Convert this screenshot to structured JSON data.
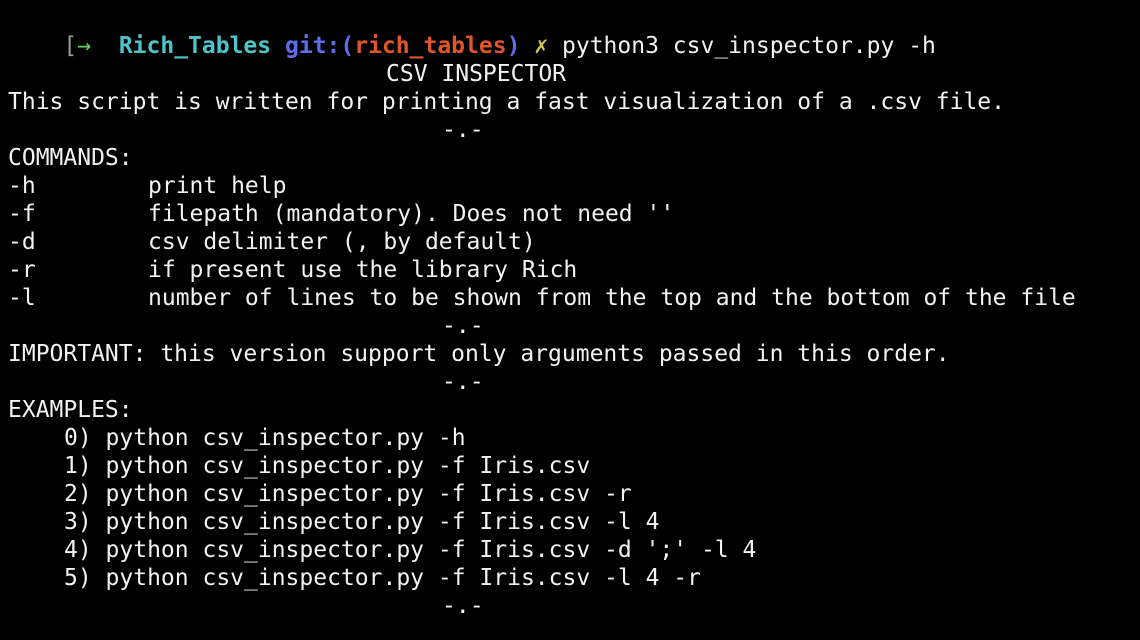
{
  "prompt": {
    "bracket": "[",
    "arrow": "→",
    "directory": "Rich_Tables",
    "git_label": "git:",
    "git_open": "(",
    "branch": "rich_tables",
    "git_close": ")",
    "dirty_marker": "✗",
    "command": "python3 csv_inspector.py -h"
  },
  "help": {
    "title": "CSV INSPECTOR",
    "description": "This script is written for printing a fast visualization of a .csv file.",
    "separator": "-.-",
    "commands_header": "COMMANDS:",
    "commands": [
      {
        "flag": "-h",
        "text": "print help"
      },
      {
        "flag": "-f",
        "text": "filepath (mandatory). Does not need ''"
      },
      {
        "flag": "-d",
        "text": "csv delimiter (, by default)"
      },
      {
        "flag": "-r",
        "text": "if present use the library Rich"
      },
      {
        "flag": "-l",
        "text": "number of lines to be shown from the top and the bottom of the file"
      }
    ],
    "important": "IMPORTANT: this version support only arguments passed in this order.",
    "examples_header": "EXAMPLES:",
    "examples": [
      "0) python csv_inspector.py -h",
      "1) python csv_inspector.py -f Iris.csv",
      "2) python csv_inspector.py -f Iris.csv -r",
      "3) python csv_inspector.py -f Iris.csv -l 4",
      "4) python csv_inspector.py -f Iris.csv -d ';' -l 4",
      "5) python csv_inspector.py -f Iris.csv -l 4 -r"
    ]
  },
  "colors": {
    "background": "#000000",
    "text": "#f2f2f2",
    "arrow": "#5fd35f",
    "directory": "#4fc3c7",
    "git": "#5f6ee8",
    "branch": "#e0562b",
    "dirty": "#d7c94b"
  }
}
